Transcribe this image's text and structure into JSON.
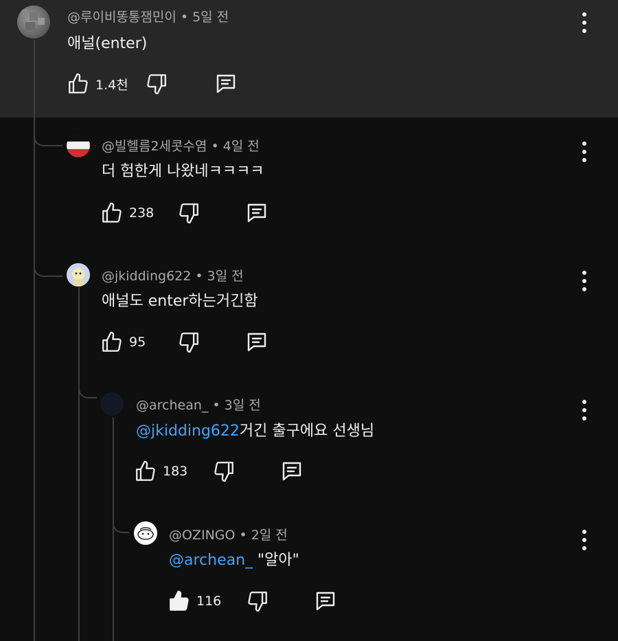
{
  "comments": [
    {
      "author": "@루이비똥통잼민이",
      "time": "5일 전",
      "text": "애널(enter)",
      "likes": "1.4천"
    },
    {
      "author": "@빌헬름2세콧수염",
      "time": "4일 전",
      "text": "더 험한게 나왔네ㅋㅋㅋㅋ",
      "likes": "238"
    },
    {
      "author": "@jkidding622",
      "time": "3일 전",
      "text": "애널도 enter하는거긴함",
      "likes": "95"
    },
    {
      "author": "@archean_",
      "time": "3일 전",
      "mention": "@jkidding622",
      "text": "거긴 출구에요 선생님",
      "likes": "183"
    },
    {
      "author": "@OZINGO",
      "time": "2일 전",
      "mention": "@archean_",
      "text": " \"알아\"",
      "likes": "116"
    }
  ],
  "separator": "•",
  "colors": {
    "background": "#0f0f0f",
    "highlight": "#272727",
    "mention": "#3ea6ff",
    "meta": "#aaaaaa"
  },
  "icons": [
    "thumbs-up-icon",
    "thumbs-down-icon",
    "reply-icon",
    "more-vert-icon"
  ]
}
